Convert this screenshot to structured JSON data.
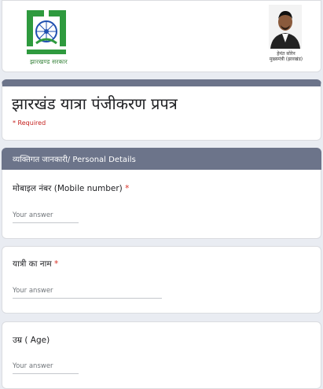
{
  "header": {
    "logo_caption": "झारखण्ड सरकार",
    "portrait_name_line1": "हेमंत सोरेन",
    "portrait_name_line2": "मुख्यमंत्री (झारखंड)"
  },
  "form": {
    "title": "झारखंड यात्रा पंजीकरण प्रपत्र",
    "required_note": "* Required"
  },
  "section": {
    "title": "व्यक्तिगत जानकारी/ Personal Details"
  },
  "questions": [
    {
      "label": "मोबाइल नंबर (Mobile number)",
      "required_mark": "*",
      "placeholder": "Your answer",
      "value": ""
    },
    {
      "label": "यात्री का नाम",
      "required_mark": "*",
      "placeholder": "Your answer",
      "value": ""
    },
    {
      "label": "उम्र ( Age)",
      "required_mark": "",
      "placeholder": "Your answer",
      "value": ""
    }
  ],
  "colors": {
    "accent": "#6c748a",
    "required": "#d93025",
    "logo_green": "#2e9a3e",
    "logo_blue": "#1f4fb0"
  }
}
